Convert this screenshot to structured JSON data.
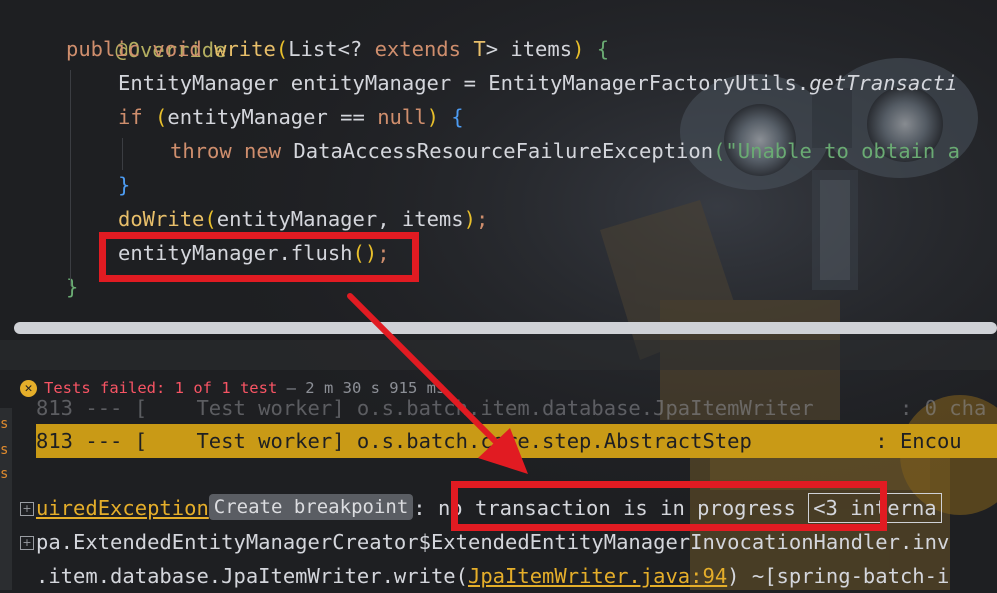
{
  "editor": {
    "line_override": "@Override",
    "line_sig": {
      "kw_public": "public",
      "kw_void": "void",
      "method": "write",
      "p1": "(",
      "type_list": "List",
      "lt": "<",
      "q": "? ",
      "kw_extends": "extends",
      "tparam": " T",
      "gt": ">",
      "param": " items",
      "p2": ")",
      "brace": " {"
    },
    "line_em": {
      "type": "EntityManager",
      "var": " entityManager = ",
      "factory": "EntityManagerFactoryUtils.",
      "call": "getTransacti"
    },
    "line_if": {
      "kw": "if",
      "open": " (",
      "cond": "entityManager == ",
      "kw_null": "null",
      "close": ")",
      "brace": " {"
    },
    "line_throw": {
      "kw_throw": "throw",
      "kw_new": " new",
      "exc": " DataAccessResourceFailureException",
      "paren": "(",
      "str": "\"Unable to obtain a"
    },
    "line_close_if": "}",
    "line_dowrite": {
      "fn": "doWrite",
      "p1": "(",
      "args": "entityManager, items",
      "p2": ")",
      "semi": ";"
    },
    "line_flush": {
      "obj": "entityManager.",
      "fn": "flush",
      "p1": "(",
      "p2": ")",
      "semi": ";"
    },
    "line_close_method": "}"
  },
  "run_panel": {
    "status": {
      "icon": "x-icon",
      "label": "Tests failed: ",
      "count": "1 of 1 test",
      "time": " – 2 m 30 s 915 ms"
    },
    "gutter_chars": [
      "s",
      "s",
      "s"
    ],
    "log_partial": "813 --- [    Test worker] o.s.batch.item.database.JpaItemWriter       : 0 cha",
    "log_highlight": "813 --- [    Test worker] o.s.batch.core.step.AbstractStep          : Encou",
    "exception_line": {
      "link": "uiredException",
      "badge": "Create breakpoint",
      "message": ": no transaction is in progress",
      "internal": "<3 interna"
    },
    "stack_line_1": "pa.ExtendedEntityManagerCreator$ExtendedEntityManagerInvocationHandler.inv",
    "stack_line_2": {
      "prefix": ".item.database.JpaItemWriter.write(",
      "link": "JpaItemWriter.java:94",
      "suffix": ") ~[spring-batch-i"
    }
  },
  "colors": {
    "annotation_red": "#e11b22",
    "highlight_row": "#c99a16",
    "keyword": "#cf8e6d",
    "function": "#56a8f5",
    "string": "#6aab73"
  }
}
